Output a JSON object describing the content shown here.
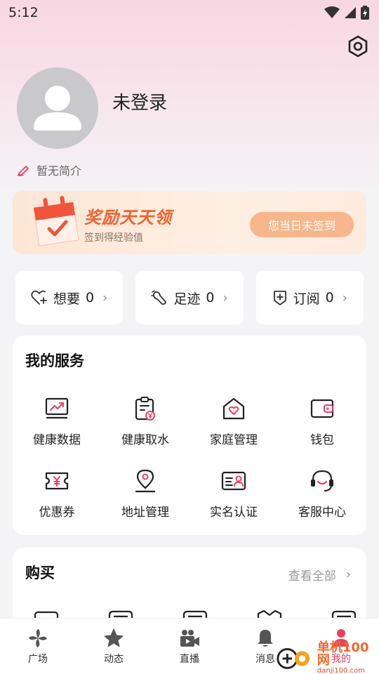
{
  "status_bar": {
    "time": "5:12"
  },
  "profile": {
    "username": "未登录",
    "bio": "暂无简介"
  },
  "signin": {
    "title": "奖励天天领",
    "subtitle": "签到得经验值",
    "button": "您当日未签到"
  },
  "quick_links": [
    {
      "label": "想要",
      "count": "0",
      "icon": "heart-plus-icon"
    },
    {
      "label": "足迹",
      "count": "0",
      "icon": "footprint-icon"
    },
    {
      "label": "订阅",
      "count": "0",
      "icon": "subscribe-icon"
    }
  ],
  "services": {
    "title": "我的服务",
    "items": [
      {
        "label": "健康数据",
        "icon": "chart-icon"
      },
      {
        "label": "健康取水",
        "icon": "clipboard-yen-icon"
      },
      {
        "label": "家庭管理",
        "icon": "house-heart-icon"
      },
      {
        "label": "钱包",
        "icon": "wallet-icon"
      },
      {
        "label": "优惠券",
        "icon": "coupon-icon"
      },
      {
        "label": "地址管理",
        "icon": "location-pin-icon"
      },
      {
        "label": "实名认证",
        "icon": "id-card-icon"
      },
      {
        "label": "客服中心",
        "icon": "headset-icon"
      }
    ]
  },
  "purchase": {
    "title": "购买",
    "view_all": "查看全部"
  },
  "tabs": [
    {
      "label": "广场",
      "icon": "pinwheel-icon"
    },
    {
      "label": "动态",
      "icon": "star-icon"
    },
    {
      "label": "直播",
      "icon": "video-camera-icon"
    },
    {
      "label": "消息",
      "icon": "bell-icon"
    },
    {
      "label": "我的",
      "icon": "person-icon",
      "active": true
    }
  ],
  "watermark": {
    "text": "单机100网",
    "url": "danji100.com"
  },
  "colors": {
    "accent": "#ef3d62",
    "signin_title": "#f0622e",
    "signin_button": "#f8b68c"
  }
}
